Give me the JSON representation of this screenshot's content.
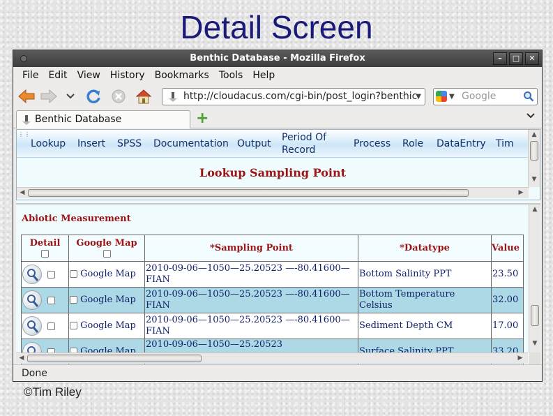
{
  "slide": {
    "title": "Detail Screen",
    "credit": "©Tim Riley"
  },
  "window": {
    "title": "Benthic Database - Mozilla Firefox"
  },
  "menu": [
    "File",
    "Edit",
    "View",
    "History",
    "Bookmarks",
    "Tools",
    "Help"
  ],
  "navbar": {
    "url": "http://cloudacus.com/cgi-bin/post_login?benthic",
    "search_placeholder": "Google"
  },
  "tab": {
    "label": "Benthic Database"
  },
  "topnav": {
    "items": [
      "Lookup",
      "Insert",
      "SPSS",
      "Documentation",
      "Output",
      "Period Of Record",
      "Process",
      "Role",
      "DataEntry",
      "Tim"
    ]
  },
  "lookup_title": "Lookup Sampling Point",
  "abiotic": {
    "title": "Abiotic Measurement",
    "headers": {
      "detail": "Detail",
      "google_map": "Google Map",
      "sampling_point": "*Sampling Point",
      "datatype": "*Datatype",
      "value": "Value"
    },
    "rows": [
      {
        "map": "Google Map",
        "sampling_point": "2010-09-06—1050—25.20523 —-80.41600—FIAN",
        "datatype": "Bottom Salinity PPT",
        "value": "23.50"
      },
      {
        "map": "Google Map",
        "sampling_point": "2010-09-06—1050—25.20523 —-80.41600—FIAN",
        "datatype": "Bottom Temperature Celsius",
        "value": "32.00"
      },
      {
        "map": "Google Map",
        "sampling_point": "2010-09-06—1050—25.20523 —-80.41600—FIAN",
        "datatype": "Sediment Depth CM",
        "value": "17.00"
      },
      {
        "map": "Google Map",
        "sampling_point": "2010-09-06—1050—25.20523",
        "datatype": "Surface Salinity PPT",
        "value": "33.20"
      }
    ]
  },
  "status": "Done"
}
